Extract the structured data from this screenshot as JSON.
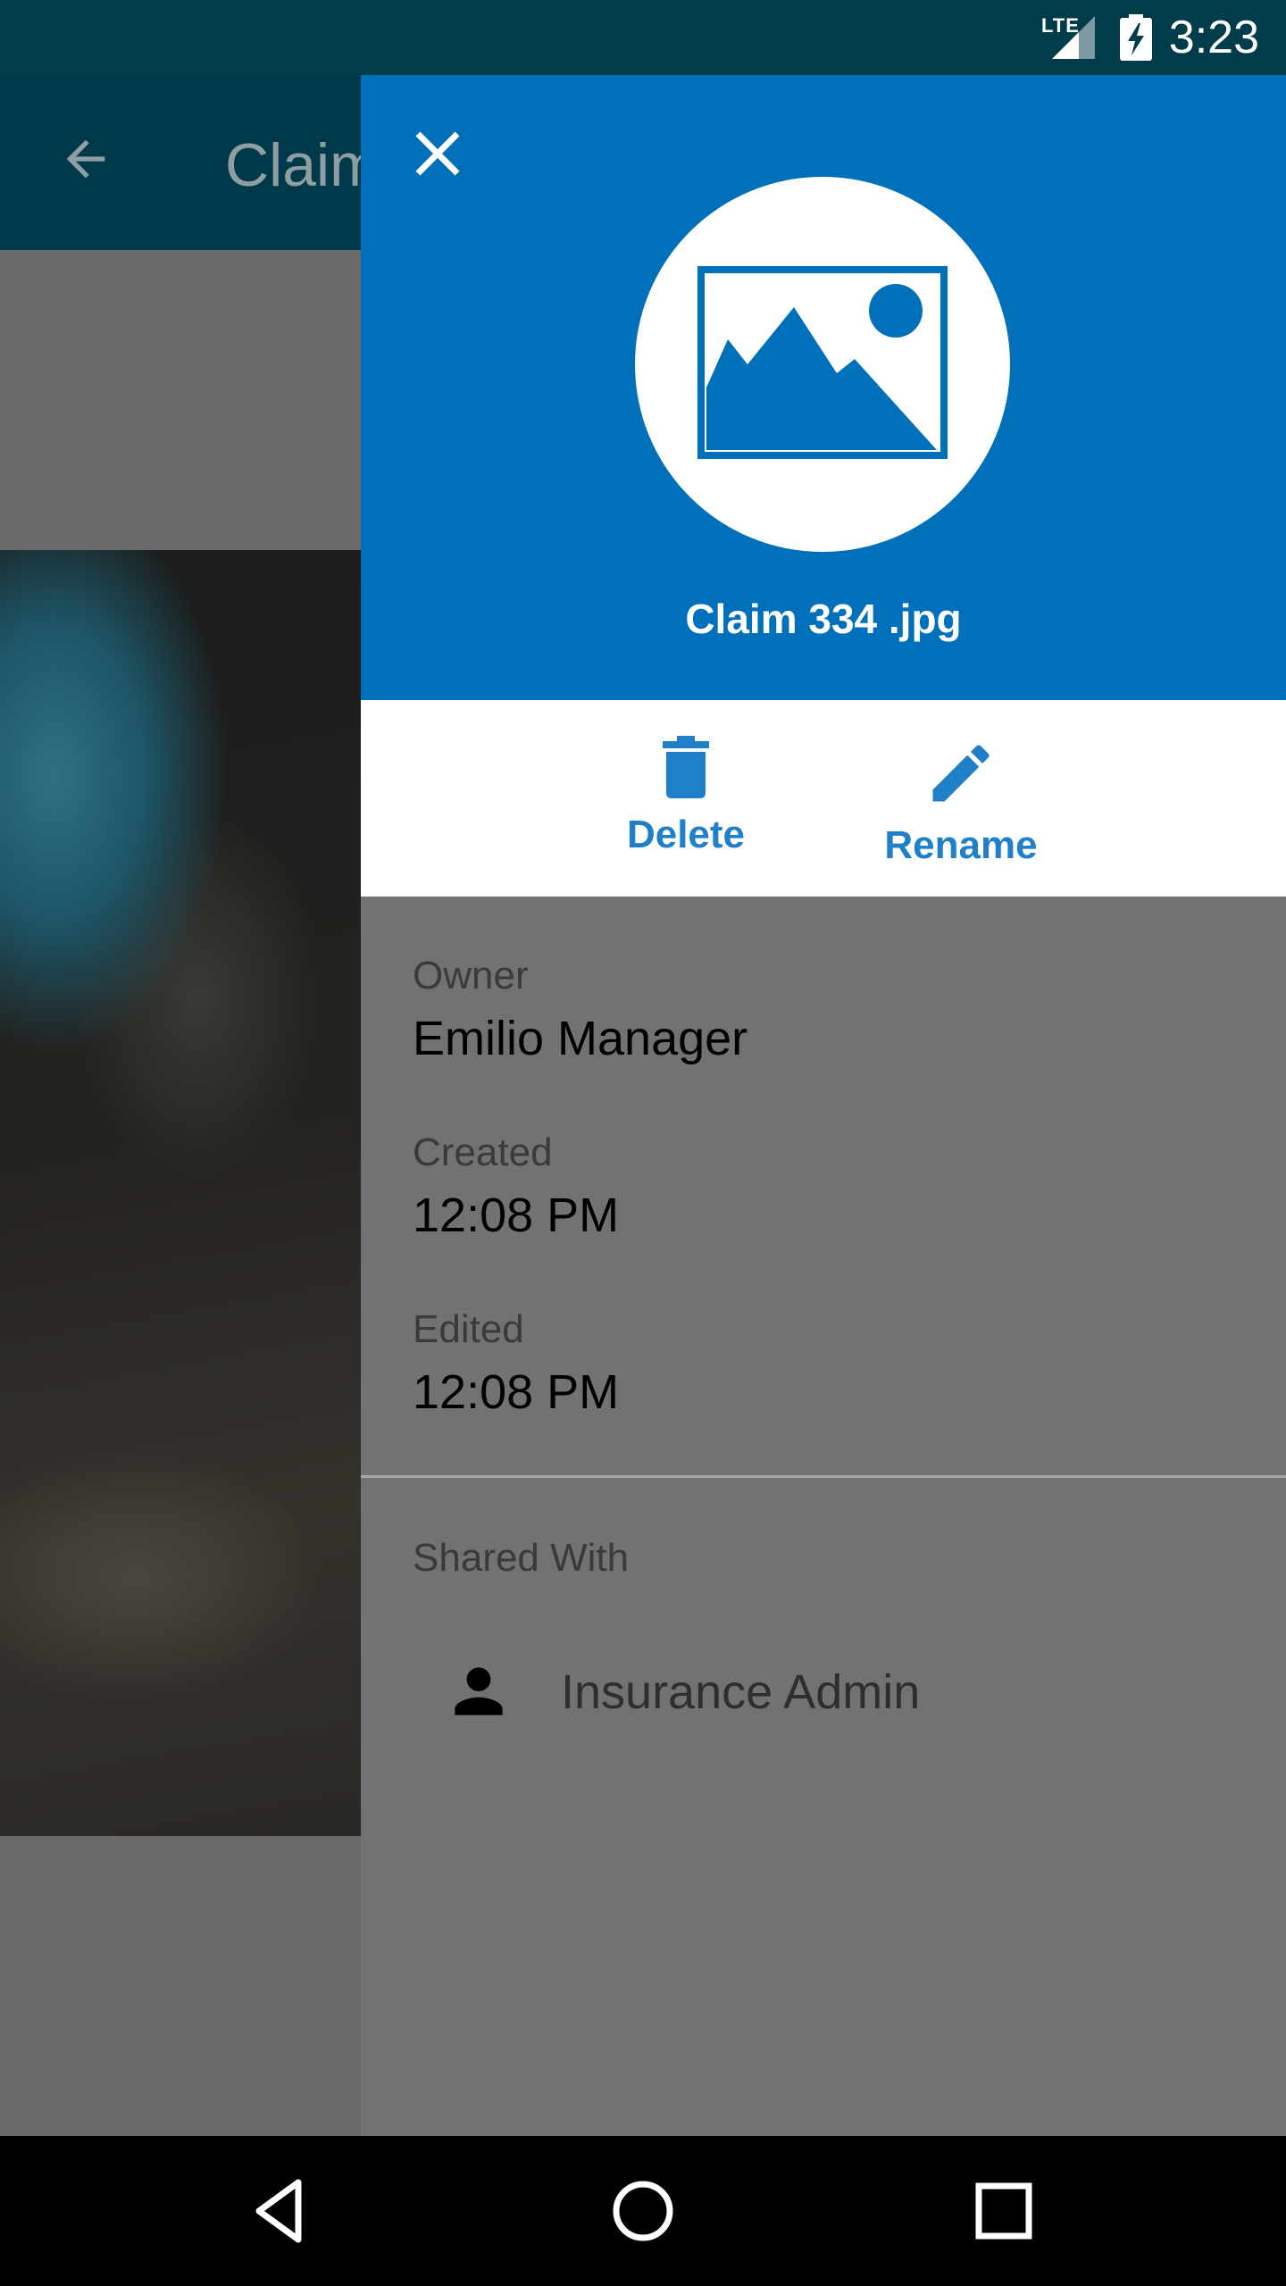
{
  "status_bar": {
    "time": "3:23",
    "network": "LTE"
  },
  "background": {
    "title": "Claim"
  },
  "drawer": {
    "file_name": "Claim 334 .jpg",
    "actions": {
      "delete": "Delete",
      "rename": "Rename"
    },
    "details": [
      {
        "label": "Owner",
        "value": "Emilio Manager"
      },
      {
        "label": "Created",
        "value": "12:08 PM"
      },
      {
        "label": "Edited",
        "value": "12:08 PM"
      }
    ],
    "shared": {
      "label": "Shared With",
      "users": [
        "Insurance Admin"
      ]
    }
  },
  "colors": {
    "accent": "#0070bb",
    "action_text": "#1f7fc9",
    "status_bar": "#003c4a"
  },
  "icons": {
    "close": "close-icon",
    "image": "image-icon",
    "delete": "trash-icon",
    "rename": "pencil-icon",
    "user": "person-icon",
    "back": "arrow-back-icon"
  }
}
